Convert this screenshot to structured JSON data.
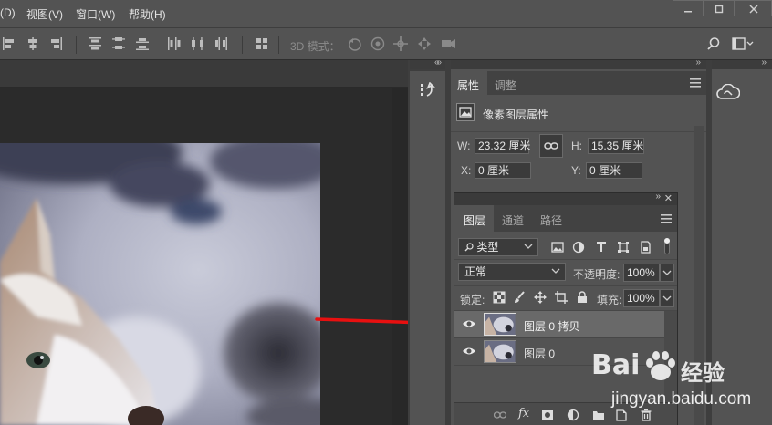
{
  "menu": {
    "items": [
      "(D)",
      "视图(V)",
      "窗口(W)",
      "帮助(H)"
    ]
  },
  "window_controls": [
    "min",
    "max",
    "close"
  ],
  "options_bar": {
    "mode3d_label": "3D 模式："
  },
  "properties_panel": {
    "tabs": [
      "属性",
      "调整"
    ],
    "subtitle": "像素图层属性",
    "width_label": "W:",
    "width_value": "23.32 厘米",
    "height_label": "H:",
    "height_value": "15.35 厘米",
    "x_label": "X:",
    "x_value": "0 厘米",
    "y_label": "Y:",
    "y_value": "0 厘米"
  },
  "layers_panel": {
    "tabs": [
      "图层",
      "通道",
      "路径"
    ],
    "filter_kind": "类型",
    "blend_mode": "正常",
    "opacity_label": "不透明度:",
    "opacity_value": "100%",
    "lock_label": "锁定:",
    "fill_label": "填充:",
    "fill_value": "100%",
    "layers": [
      {
        "name": "图层 0 拷贝",
        "selected": true
      },
      {
        "name": "图层 0",
        "selected": false
      }
    ]
  },
  "watermark": {
    "brand_text": "Bai",
    "brand_suffix": "经验",
    "url": "jingyan.baidu.com"
  },
  "colors": {
    "ui_bg": "#535353",
    "arrow": "#e81010",
    "selected_row": "#696969"
  }
}
